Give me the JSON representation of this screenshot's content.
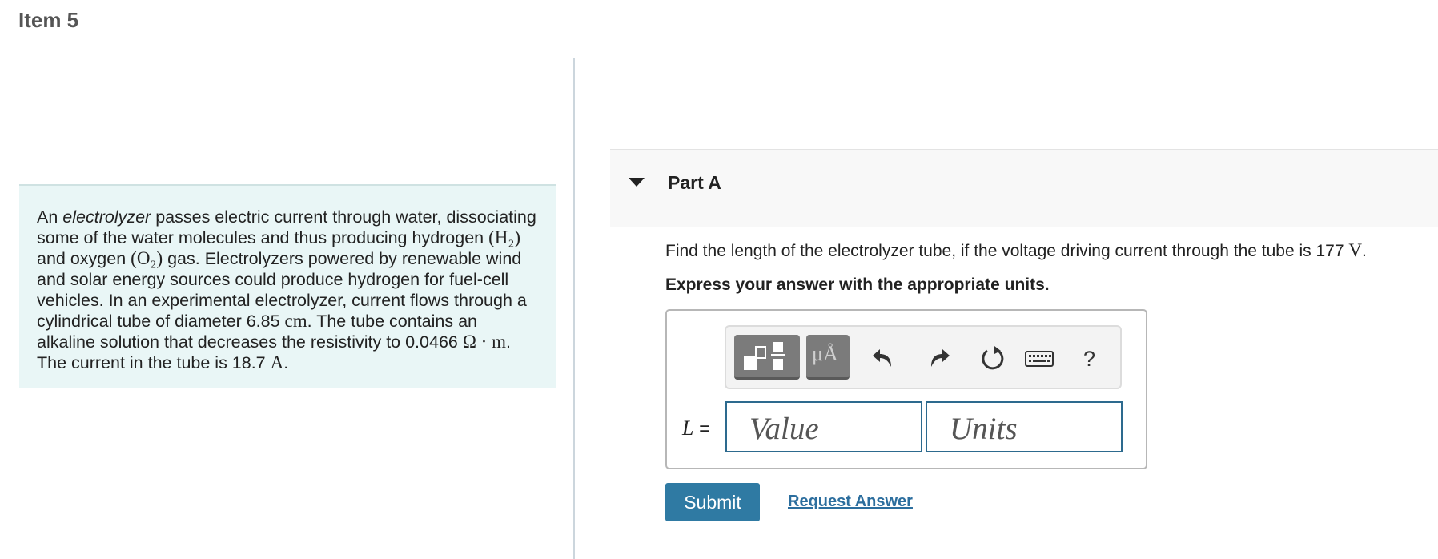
{
  "item": {
    "title": "Item 5"
  },
  "intro": {
    "pre_em": "An ",
    "em": "electrolyzer",
    "t1": " passes electric current through water, dissociating some of the water molecules and thus producing hydrogen ",
    "h2": "(H₂)",
    "t2": " and oxygen ",
    "o2": "(O₂)",
    "t3": " gas. Electrolyzers powered by renewable wind and solar energy sources could produce hydrogen for fuel-cell vehicles. In an experimental electrolyzer, current flows through a cylindrical tube of diameter 6.85 ",
    "u_cm": "cm",
    "t4": ". The tube contains an alkaline solution that decreases the resistivity to 0.0466 ",
    "u_ohm_m": "Ω · m",
    "t5": ". The current in the tube is 18.7 ",
    "u_amp": "A",
    "t6": "."
  },
  "part": {
    "label": "Part A"
  },
  "question": {
    "text": "Find the length of the electrolyzer tube, if the voltage driving current through the tube is 177 ",
    "unit": "V",
    "end": "."
  },
  "instruction": "Express your answer with the appropriate units.",
  "answer": {
    "variable": "L",
    "equals": " =",
    "value_placeholder": "Value",
    "units_placeholder": "Units"
  },
  "toolbar": {
    "icons": [
      "templates-icon",
      "units-icon",
      "undo-icon",
      "redo-icon",
      "reset-icon",
      "keyboard-icon",
      "help-icon"
    ],
    "units_symbol": "μÅ",
    "help_label": "?"
  },
  "actions": {
    "submit": "Submit",
    "request": "Request Answer"
  },
  "colors": {
    "intro_bg": "#e9f6f6",
    "button": "#2f7aa3",
    "input_border": "#2d6a8e",
    "link": "#2c6e9e"
  }
}
